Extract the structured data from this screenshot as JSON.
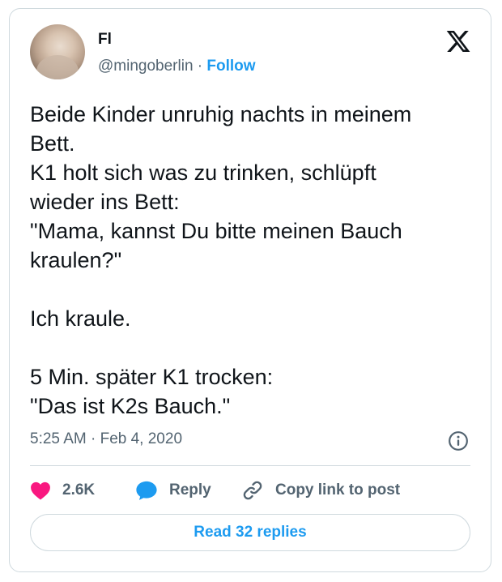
{
  "author": {
    "display_name": "Fl",
    "handle": "@mingoberlin",
    "separator": "·",
    "follow_label": "Follow"
  },
  "tweet": {
    "lines": [
      "Beide Kinder unruhig nachts in meinem",
      "Bett.",
      "K1 holt sich was zu trinken, schlüpft",
      "wieder ins Bett:",
      "\"Mama, kannst Du bitte meinen Bauch",
      "kraulen?\"",
      "",
      "Ich kraule.",
      "",
      "5 Min. später K1 trocken:",
      "\"Das ist K2s Bauch.\""
    ],
    "timestamp": "5:25 AM · Feb 4, 2020"
  },
  "actions": {
    "like_count": "2.6K",
    "reply_label": "Reply",
    "copy_label": "Copy link to post",
    "read_replies_label": "Read 32 replies"
  },
  "icons": {
    "logo": "x-logo-icon",
    "like": "heart-icon",
    "reply": "speech-bubble-icon",
    "copy": "link-icon",
    "info": "info-icon"
  },
  "colors": {
    "accent": "#1d9bf0",
    "like": "#f91880",
    "secondary_text": "#536471",
    "border": "#cfd9de"
  }
}
